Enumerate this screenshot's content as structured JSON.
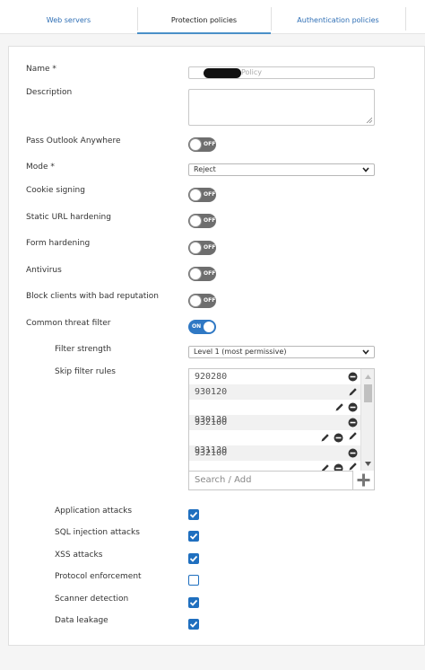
{
  "tabs": [
    {
      "label": "Web servers",
      "active": false
    },
    {
      "label": "Protection policies",
      "active": true
    },
    {
      "label": "Authentication policies",
      "active": false
    }
  ],
  "form": {
    "name": {
      "label": "Name *",
      "value": "Policy"
    },
    "description": {
      "label": "Description",
      "value": ""
    },
    "pass_outlook": {
      "label": "Pass Outlook Anywhere",
      "state": "OFF"
    },
    "mode": {
      "label": "Mode *",
      "value": "Reject"
    },
    "cookie_signing": {
      "label": "Cookie signing",
      "state": "OFF"
    },
    "static_url": {
      "label": "Static URL hardening",
      "state": "OFF"
    },
    "form_hardening": {
      "label": "Form hardening",
      "state": "OFF"
    },
    "antivirus": {
      "label": "Antivirus",
      "state": "OFF"
    },
    "block_clients": {
      "label": "Block clients with bad reputation",
      "state": "OFF"
    },
    "common_threat": {
      "label": "Common threat filter",
      "state": "ON"
    },
    "filter_strength": {
      "label": "Filter strength",
      "value": "Level 1 (most permissive)"
    },
    "skip_rules": {
      "label": "Skip filter rules",
      "rows": [
        "920280",
        "930120",
        "",
        "932100",
        "",
        "932100",
        ""
      ],
      "overlap": [
        "",
        "",
        "",
        "930130",
        "",
        "931130",
        ""
      ],
      "search_placeholder": "Search / Add"
    },
    "checks": [
      {
        "label": "Application attacks",
        "checked": true
      },
      {
        "label": "SQL injection attacks",
        "checked": true
      },
      {
        "label": "XSS attacks",
        "checked": true
      },
      {
        "label": "Protocol enforcement",
        "checked": false
      },
      {
        "label": "Scanner detection",
        "checked": true
      },
      {
        "label": "Data leakage",
        "checked": true
      }
    ]
  },
  "colors": {
    "accent": "#1f6fbf",
    "toggle_on": "#2f78c4",
    "toggle_off": "#6e6e6e",
    "tab_link": "#2f6fb5"
  }
}
